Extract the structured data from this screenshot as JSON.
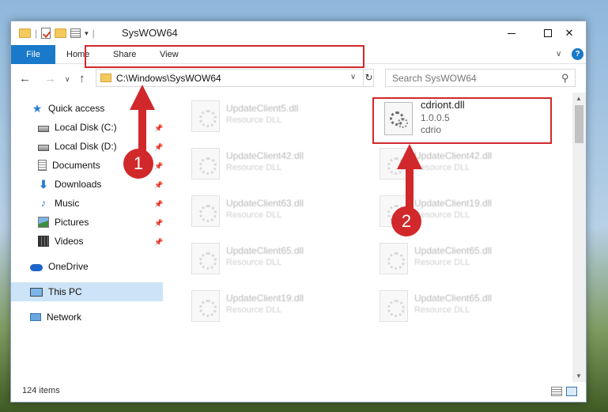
{
  "window": {
    "title": "SysWOW64"
  },
  "ribbon": {
    "tabs": [
      "File",
      "Home",
      "Share",
      "View"
    ],
    "help_label": "?"
  },
  "navigation": {
    "address": "C:\\Windows\\SysWOW64",
    "search_placeholder": "Search SysWOW64"
  },
  "sidebar": {
    "items": [
      {
        "label": "Quick access",
        "icon": "star-icon"
      },
      {
        "label": "Local Disk (C:)",
        "icon": "disk-icon",
        "pinned": true
      },
      {
        "label": "Local Disk (D:)",
        "icon": "disk-icon",
        "pinned": true
      },
      {
        "label": "Documents",
        "icon": "document-icon",
        "pinned": true
      },
      {
        "label": "Downloads",
        "icon": "download-icon",
        "pinned": true
      },
      {
        "label": "Music",
        "icon": "music-icon",
        "pinned": true
      },
      {
        "label": "Pictures",
        "icon": "picture-icon",
        "pinned": true
      },
      {
        "label": "Videos",
        "icon": "video-icon",
        "pinned": true
      },
      {
        "label": "OneDrive",
        "icon": "cloud-icon"
      },
      {
        "label": "This PC",
        "icon": "computer-icon",
        "selected": true
      },
      {
        "label": "Network",
        "icon": "network-icon"
      }
    ]
  },
  "files": {
    "left_column": [
      {
        "name": "UpdateClient5.dll",
        "type": "Resource DLL"
      },
      {
        "name": "UpdateClient42.dll",
        "type": "Resource DLL"
      },
      {
        "name": "UpdateClient63.dll",
        "type": "Resource DLL"
      },
      {
        "name": "UpdateClient65.dll",
        "type": "Resource DLL"
      },
      {
        "name": "UpdateClient19.dll",
        "type": "Resource DLL"
      }
    ],
    "highlighted": {
      "name": "cdriont.dll",
      "version": "1.0.0.5",
      "description": "cdrio"
    },
    "right_column": [
      {
        "name": "UpdateClient42.dll",
        "type": "Resource DLL"
      },
      {
        "name": "UpdateClient19.dll",
        "type": "Resource DLL"
      },
      {
        "name": "UpdateClient65.dll",
        "type": "Resource DLL"
      },
      {
        "name": "UpdateClient65.dll",
        "type": "Resource DLL"
      }
    ]
  },
  "status": {
    "item_count": "124 items"
  },
  "annotations": {
    "badge_1": "1",
    "badge_2": "2",
    "highlight_color": "#d1292b"
  },
  "colors": {
    "accent": "#1979ca",
    "selected_bg": "#cce4f7"
  }
}
